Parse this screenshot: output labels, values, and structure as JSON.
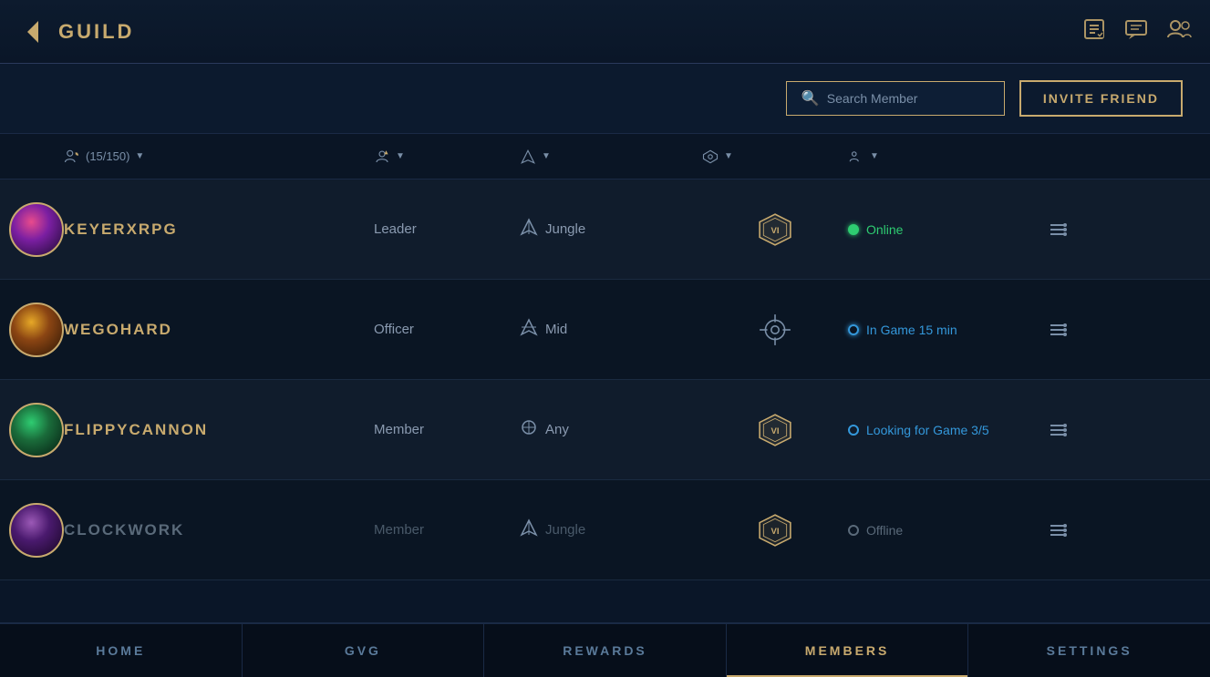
{
  "header": {
    "back_label": "◀",
    "title": "GUILD",
    "icons": [
      "checklist",
      "chat",
      "friends"
    ]
  },
  "topbar": {
    "search_placeholder": "Search Member",
    "invite_label": "INVITE FRIEND"
  },
  "columns": {
    "members_count": "(15/150)",
    "role_label": "role",
    "lane_label": "lane",
    "rank_label": "rank",
    "status_label": "status"
  },
  "members": [
    {
      "name": "KEYERXRPG",
      "role": "Leader",
      "lane": "Jungle",
      "status": "Online",
      "status_type": "online",
      "avatar_class": "avatar-circle-1",
      "offline": false
    },
    {
      "name": "WEGOHARD",
      "role": "Officer",
      "lane": "Mid",
      "status": "In Game 15 min",
      "status_type": "ingame",
      "avatar_class": "avatar-circle-2",
      "offline": false
    },
    {
      "name": "FLIPPYCANNON",
      "role": "Member",
      "lane": "Any",
      "status": "Looking for Game 3/5",
      "status_type": "lfg",
      "avatar_class": "avatar-circle-3",
      "offline": false
    },
    {
      "name": "CLOCKWORK",
      "role": "Member",
      "lane": "Jungle",
      "status": "Offline",
      "status_type": "offline",
      "avatar_class": "avatar-circle-4",
      "offline": true
    }
  ],
  "nav": {
    "items": [
      "HOME",
      "GVG",
      "REWARDS",
      "MEMBERS",
      "SETTINGS"
    ],
    "active": "MEMBERS"
  }
}
